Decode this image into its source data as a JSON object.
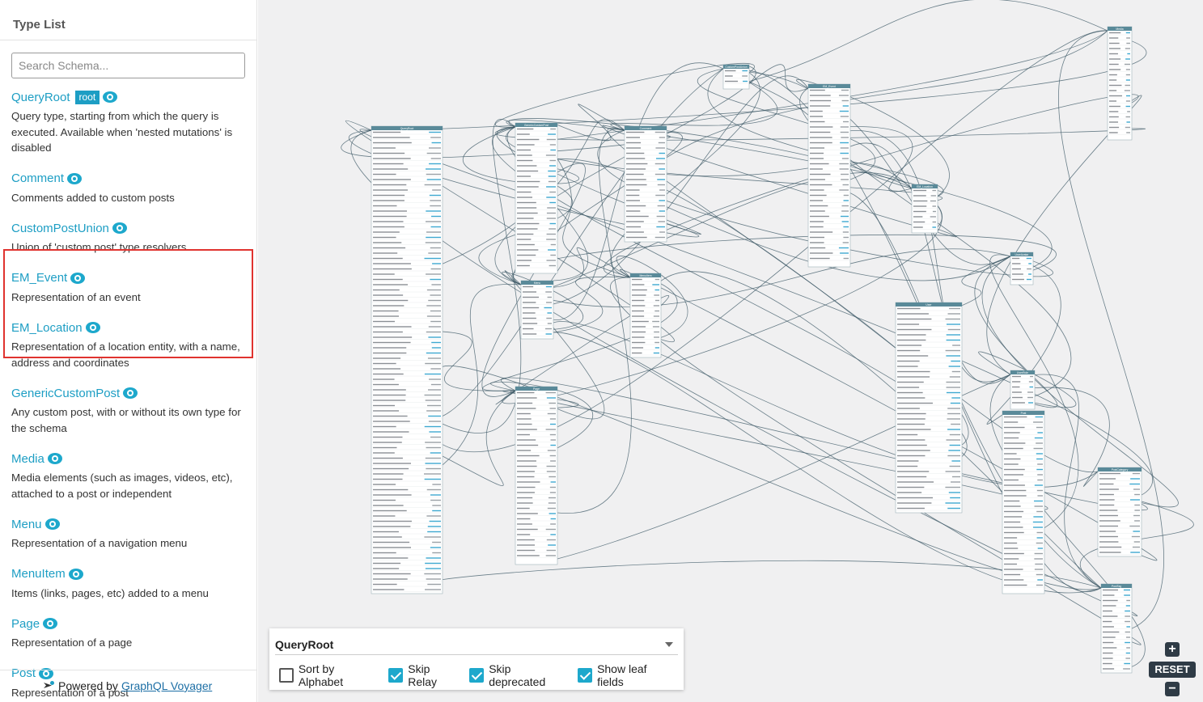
{
  "sidebar": {
    "title": "Type List",
    "search_placeholder": "Search Schema...",
    "items": [
      {
        "name": "QueryRoot",
        "badge": "root",
        "desc": "Query type, starting from which the query is executed. Available when 'nested mutations' is disabled"
      },
      {
        "name": "Comment",
        "desc": "Comments added to custom posts"
      },
      {
        "name": "CustomPostUnion",
        "desc": "Union of 'custom post' type resolvers"
      },
      {
        "name": "EM_Event",
        "desc": "Representation of an event"
      },
      {
        "name": "EM_Location",
        "desc": "Representation of a location entity, with a name, address and coordinates"
      },
      {
        "name": "GenericCustomPost",
        "desc": "Any custom post, with or without its own type for the schema"
      },
      {
        "name": "Media",
        "desc": "Media elements (such as images, videos, etc), attached to a post or independent"
      },
      {
        "name": "Menu",
        "desc": "Representation of a navigation menu"
      },
      {
        "name": "MenuItem",
        "desc": "Items (links, pages, etc) added to a menu"
      },
      {
        "name": "Page",
        "desc": "Representation of a page"
      },
      {
        "name": "Post",
        "desc": "Representation of a post"
      }
    ],
    "powered_prefix": "Powered by",
    "powered_link": "GraphQL Voyager"
  },
  "panel": {
    "root_value": "QueryRoot",
    "options": [
      {
        "label": "Sort by Alphabet",
        "checked": false
      },
      {
        "label": "Skip Relay",
        "checked": true
      },
      {
        "label": "Skip deprecated",
        "checked": true
      },
      {
        "label": "Show leaf fields",
        "checked": true
      }
    ]
  },
  "zoom": {
    "zoom_in": "+",
    "reset": "RESET",
    "zoom_out": "−"
  },
  "graph_nodes": [
    {
      "title": "QueryRoot"
    },
    {
      "title": "GenericCustomPost"
    },
    {
      "title": "Comment"
    },
    {
      "title": "CustomPostUnion"
    },
    {
      "title": "EM_Event"
    },
    {
      "title": "EM_Location"
    },
    {
      "title": "Media"
    },
    {
      "title": "Menu"
    },
    {
      "title": "MenuItem"
    },
    {
      "title": "Page"
    },
    {
      "title": "User"
    },
    {
      "title": "UserAvatar"
    },
    {
      "title": "UserRole"
    },
    {
      "title": "Post"
    },
    {
      "title": "PostCategory"
    },
    {
      "title": "PostTag"
    }
  ],
  "colors": {
    "accent": "#1d9ec4",
    "node_header": "#5a8a99",
    "edge": "#3c5866",
    "highlight": "#e0332f"
  }
}
